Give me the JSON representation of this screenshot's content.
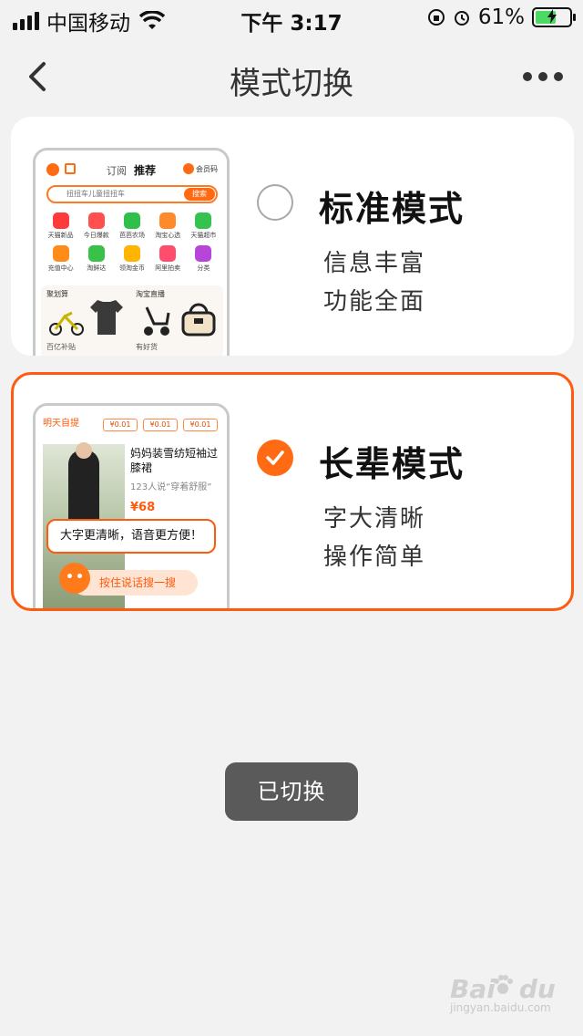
{
  "status_bar": {
    "carrier": "中国移动",
    "time": "下午 3:17",
    "battery_percent": "61%",
    "battery_level": 0.61
  },
  "nav": {
    "title": "模式切换",
    "back_icon": "chevron-left-icon",
    "more_icon": "more-dots-icon"
  },
  "modes": [
    {
      "id": "standard",
      "title": "标准模式",
      "desc": [
        "信息丰富",
        "功能全面"
      ],
      "selected": false,
      "preview": {
        "tabs": [
          "订阅",
          "推荐"
        ],
        "member": "会员码",
        "search_placeholder": "扭扭车儿童扭扭车",
        "search_button": "搜索",
        "grid": [
          {
            "label": "天猫新品",
            "color": "#ff3a3a"
          },
          {
            "label": "今日爆款",
            "color": "#ff4f4f"
          },
          {
            "label": "芭芭农场",
            "color": "#2fbf4a"
          },
          {
            "label": "淘宝心选",
            "color": "#ff8a2a"
          },
          {
            "label": "天猫超市",
            "color": "#35c24f"
          },
          {
            "label": "充值中心",
            "color": "#ff8c1a"
          },
          {
            "label": "淘鲜达",
            "color": "#38c24a"
          },
          {
            "label": "领淘金币",
            "color": "#ffb400"
          },
          {
            "label": "阿里拍卖",
            "color": "#ff4d6d"
          },
          {
            "label": "分类",
            "color": "#b845d9"
          }
        ],
        "promo_left": "聚划算",
        "promo_right": "淘宝直播",
        "promo_bottom_left": "百亿补贴",
        "promo_bottom_right": "有好货"
      }
    },
    {
      "id": "elder",
      "title": "长辈模式",
      "desc": [
        "字大清晰",
        "操作简单"
      ],
      "selected": true,
      "preview": {
        "top_label": "明天自提",
        "prices": [
          "¥0.01",
          "¥0.01",
          "¥0.01"
        ],
        "product_name": "妈妈装雪纺短袖过膝裙",
        "product_sub": "123人说“穿着舒服”",
        "product_price": "¥68",
        "bubble": "大字更清晰，语音更方便！",
        "voice_button": "按住说话搜一搜"
      }
    }
  ],
  "toast": "已切换",
  "watermark": {
    "brand": "Bai",
    "brand2": "du",
    "sub": "jingyan.baidu.com"
  },
  "colors": {
    "accent": "#ff5a0e",
    "check_fill": "#ff6a12",
    "background": "#f2f2f2",
    "toast_bg": "#5a5a5a"
  }
}
